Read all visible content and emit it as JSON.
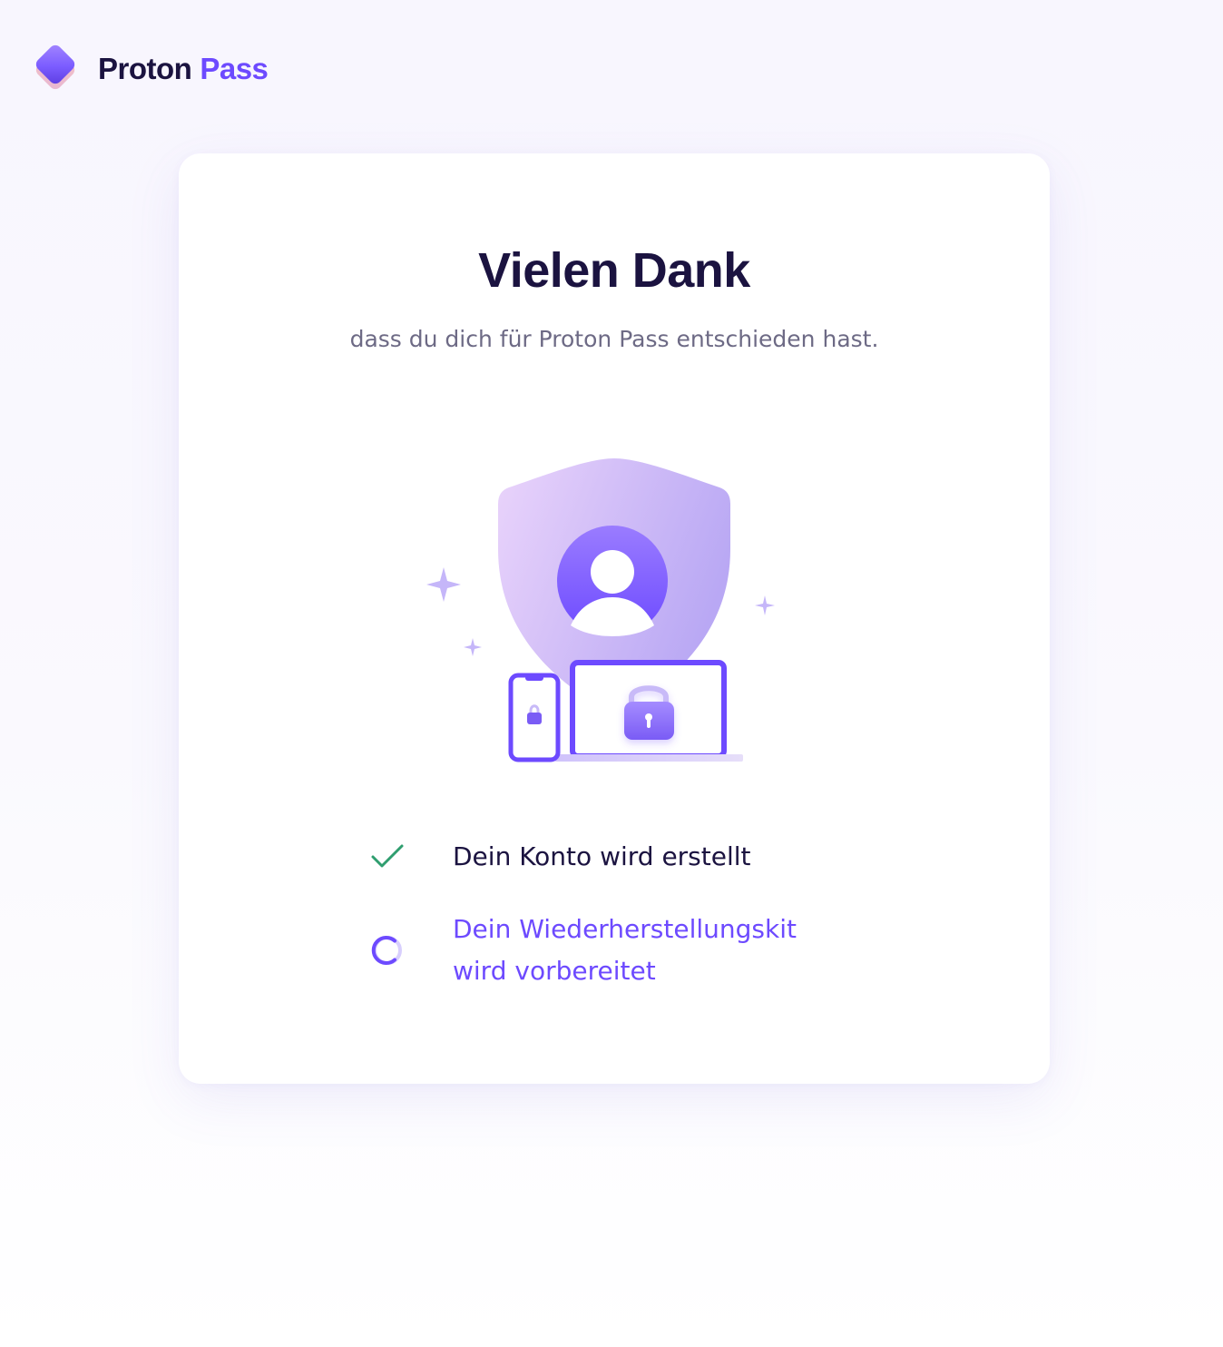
{
  "brand": {
    "name_part1": "Proton",
    "name_part2": "Pass",
    "accent_color": "#6d4aff",
    "text_color": "#1b1340"
  },
  "card": {
    "title": "Vielen Dank",
    "subtitle": "dass du dich für Proton Pass entschieden hast.",
    "illustration": {
      "icons": [
        "shield-icon",
        "user-icon",
        "phone-icon",
        "laptop-icon",
        "lock-icon",
        "sparkle-icon"
      ]
    }
  },
  "steps": [
    {
      "label": "Dein Konto wird erstellt",
      "status": "done",
      "icon": "checkmark-icon",
      "color": "#2f9e6f"
    },
    {
      "label_line1": "Dein Wiederherstellungskit",
      "label_line2": "wird vorbereitet",
      "status": "in-progress",
      "icon": "spinner-icon",
      "color": "#6d4aff"
    }
  ]
}
